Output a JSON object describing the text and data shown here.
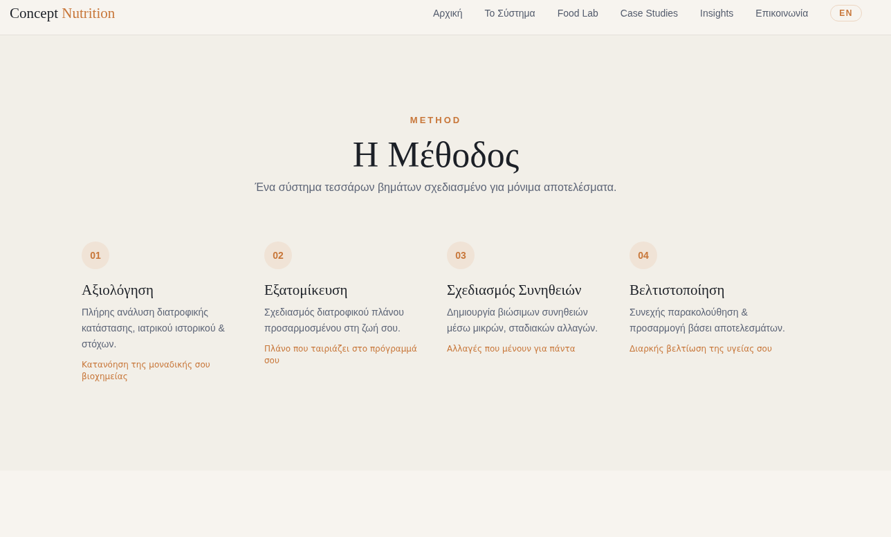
{
  "header": {
    "logo": {
      "primary": "Concept",
      "accent": "Nutrition"
    },
    "nav": [
      {
        "label": "Αρχική"
      },
      {
        "label": "Το Σύστημα"
      },
      {
        "label": "Food Lab"
      },
      {
        "label": "Case Studies"
      },
      {
        "label": "Insights"
      },
      {
        "label": "Επικοινωνία"
      }
    ],
    "language_button": "EN"
  },
  "method": {
    "eyebrow": "METHOD",
    "title": "Η Μέθοδος",
    "subtitle": "Ένα σύστημα τεσσάρων βημάτων σχεδιασμένο για μόνιμα αποτελέσματα.",
    "steps": [
      {
        "number": "01",
        "title": "Αξιολόγηση",
        "description": "Πλήρης ανάλυση διατροφικής κατάστασης, ιατρικού ιστορικού & στόχων.",
        "highlight": "Κατανόηση της μοναδικής σου βιοχημείας"
      },
      {
        "number": "02",
        "title": "Εξατομίκευση",
        "description": "Σχεδιασμός διατροφικού πλάνου προσαρμοσμένου στη ζωή σου.",
        "highlight": "Πλάνο που ταιριάζει στο πρόγραμμά σου"
      },
      {
        "number": "03",
        "title": "Σχεδιασμός Συνηθειών",
        "description": "Δημιουργία βιώσιμων συνηθειών μέσω μικρών, σταδιακών αλλαγών.",
        "highlight": "Αλλαγές που μένουν για πάντα"
      },
      {
        "number": "04",
        "title": "Βελτιστοποίηση",
        "description": "Συνεχής παρακολούθηση & προσαρμογή βάσει αποτελεσμάτων.",
        "highlight": "Διαρκής βελτίωση της υγείας σου"
      }
    ]
  }
}
